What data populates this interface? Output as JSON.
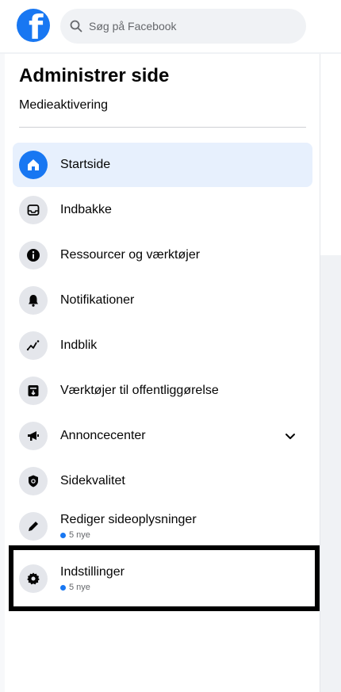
{
  "search": {
    "placeholder": "Søg på Facebook"
  },
  "panel": {
    "title": "Administrer side",
    "subtitle": "Medieaktivering"
  },
  "menu": [
    {
      "label": "Startside",
      "icon": "home-icon"
    },
    {
      "label": "Indbakke",
      "icon": "inbox-icon"
    },
    {
      "label": "Ressourcer og værktøjer",
      "icon": "info-icon"
    },
    {
      "label": "Notifikationer",
      "icon": "bell-icon"
    },
    {
      "label": "Indblik",
      "icon": "insights-icon"
    },
    {
      "label": "Værktøjer til offentliggørelse",
      "icon": "publishing-tools-icon"
    },
    {
      "label": "Annoncecenter",
      "icon": "megaphone-icon"
    },
    {
      "label": "Sidekvalitet",
      "icon": "shield-icon"
    },
    {
      "label": "Rediger sideoplysninger",
      "icon": "pencil-icon",
      "badge": "5 nye"
    },
    {
      "label": "Indstillinger",
      "icon": "gear-icon",
      "badge": "5 nye"
    }
  ],
  "colors": {
    "accent": "#1877f2",
    "active_bg": "#e7f0fd"
  }
}
